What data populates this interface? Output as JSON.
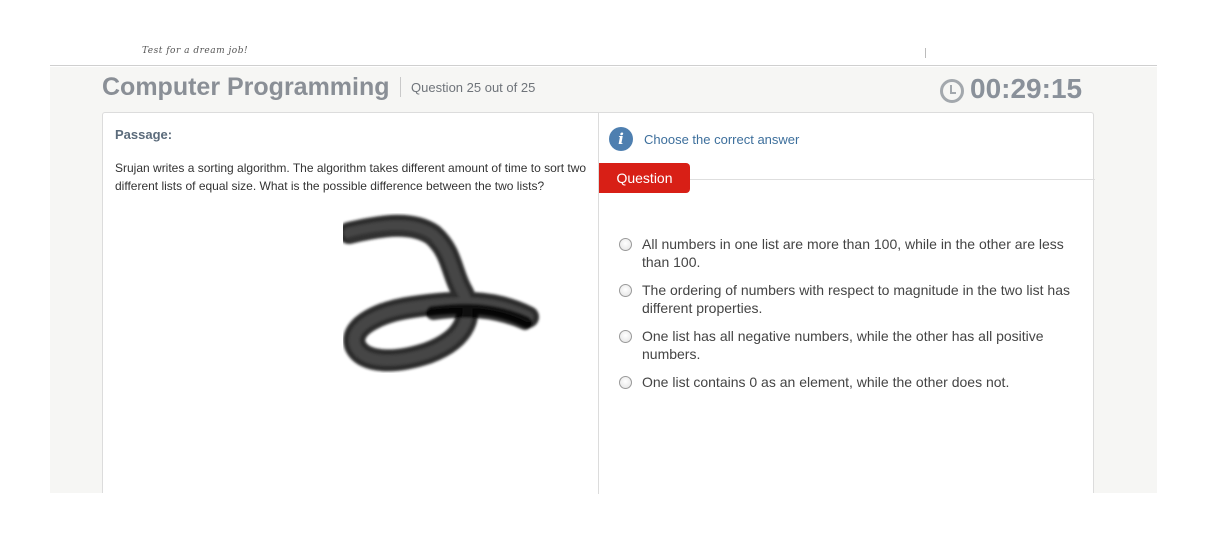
{
  "brand": {
    "tagline": "Test for a dream job!"
  },
  "header": {
    "title": "Computer Programming",
    "progress": "Question 25 out of 25",
    "timer": "00:29:15"
  },
  "passage": {
    "label": "Passage:",
    "text": "Srujan writes a sorting algorithm. The algorithm takes different amount of time to sort two different lists of equal size. What is the possible difference between the two lists?"
  },
  "instructions": {
    "text": "Choose the correct answer",
    "icon": "info-icon"
  },
  "question_tab": {
    "label": "Question"
  },
  "options": [
    {
      "text": "All numbers in one list are more than 100, while in the other are less than 100.",
      "selected": false
    },
    {
      "text": "The ordering of numbers with respect to magnitude in the two list has different properties.",
      "selected": false
    },
    {
      "text": "One list has all negative numbers, while the other has all positive numbers.",
      "selected": false
    },
    {
      "text": "One list contains 0 as an element, while the other does not.",
      "selected": false
    }
  ],
  "colors": {
    "accent_red": "#d81f16",
    "info_blue": "#4e7fb0",
    "title_gray": "#8a8f96"
  }
}
